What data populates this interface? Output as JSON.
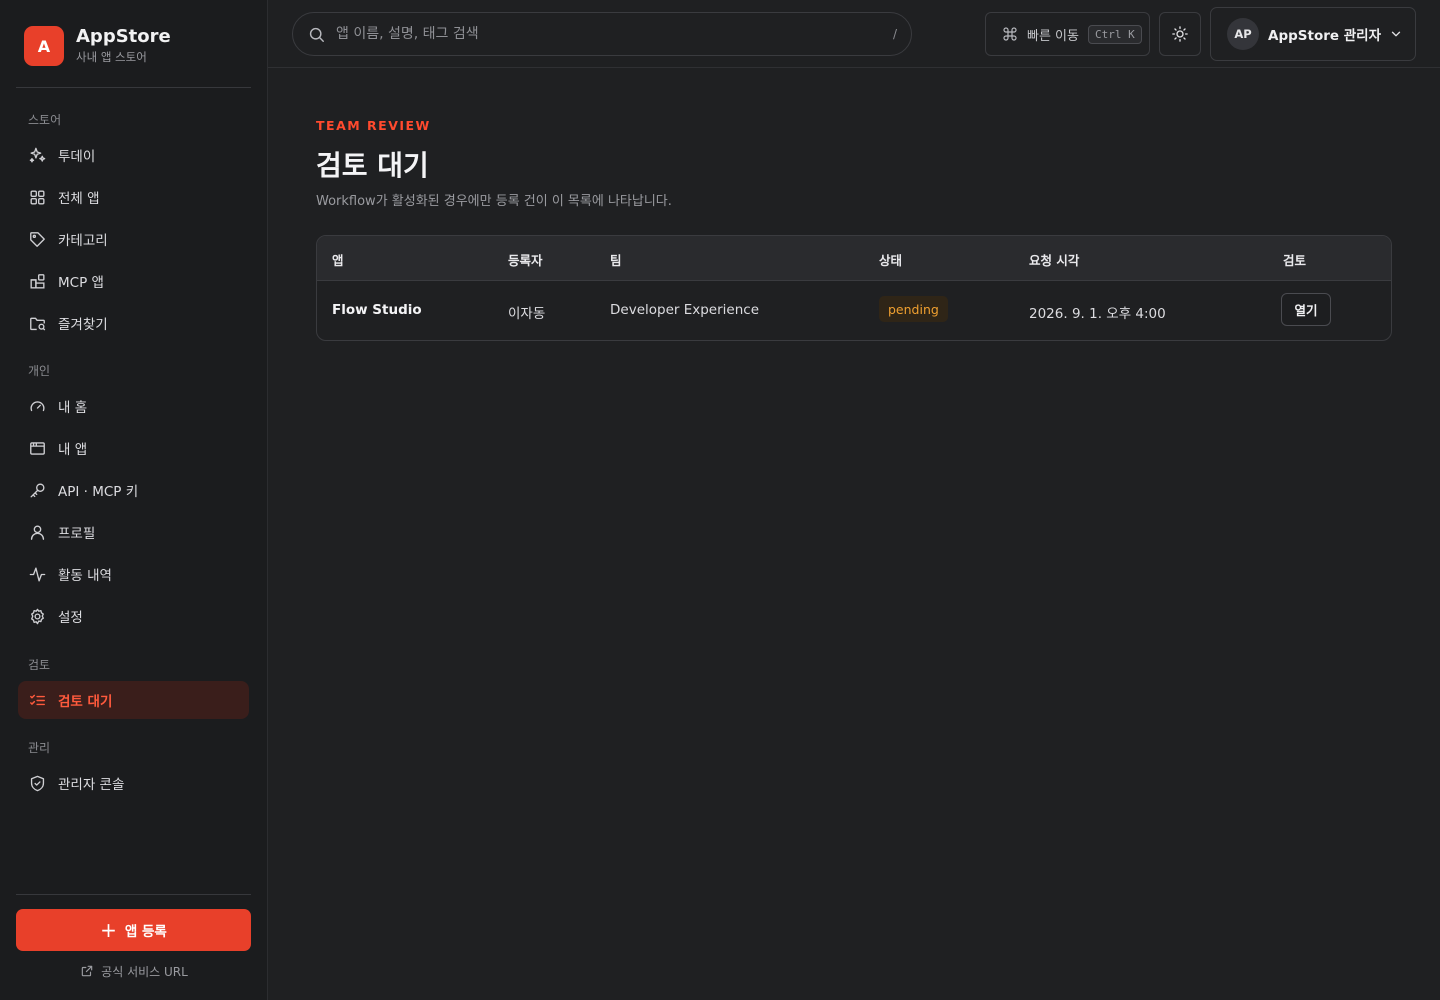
{
  "brand": {
    "logo_letter": "A",
    "name": "AppStore",
    "subtitle": "사내 앱 스토어"
  },
  "sidebar": {
    "sections": {
      "store": "스토어",
      "personal": "개인",
      "review": "검토",
      "admin": "관리"
    },
    "items": [
      {
        "label": "투데이",
        "icon": "sparkles-icon"
      },
      {
        "label": "전체 앱",
        "icon": "grid-icon"
      },
      {
        "label": "카테고리",
        "icon": "tag-icon"
      },
      {
        "label": "MCP 앱",
        "icon": "blocks-icon"
      },
      {
        "label": "즐겨찾기",
        "icon": "folder-search-icon"
      },
      {
        "label": "내 홈",
        "icon": "gauge-icon"
      },
      {
        "label": "내 앱",
        "icon": "app-window-icon"
      },
      {
        "label": "API · MCP 키",
        "icon": "key-icon"
      },
      {
        "label": "프로필",
        "icon": "user-icon"
      },
      {
        "label": "활동 내역",
        "icon": "activity-icon"
      },
      {
        "label": "설정",
        "icon": "gear-icon"
      },
      {
        "label": "검토 대기",
        "icon": "list-checks-icon",
        "active": true
      },
      {
        "label": "관리자 콘솔",
        "icon": "shield-icon"
      }
    ],
    "register_label": "앱 등록",
    "official_link_label": "공식 서비스 URL"
  },
  "header": {
    "search_placeholder": "앱 이름, 설명, 태그 검색",
    "search_shortcut": "/",
    "quick_label": "빠른 이동",
    "quick_shortcut": "Ctrl K",
    "user_initials": "AP",
    "user_name": "AppStore 관리자"
  },
  "main": {
    "eyebrow": "TEAM REVIEW",
    "title": "검토 대기",
    "description": "Workflow가 활성화된 경우에만 등록 건이 이 목록에 나타납니다.",
    "table": {
      "columns": [
        "앱",
        "등록자",
        "팀",
        "상태",
        "요청 시각",
        "검토"
      ],
      "rows": [
        {
          "app": "Flow Studio",
          "registrant": "이자동",
          "team": "Developer Experience",
          "status": "pending",
          "requested_at": "2026. 9. 1. 오후 4:00",
          "action": "열기"
        }
      ]
    }
  },
  "colors": {
    "accent": "#e8402a",
    "pending": "#f0a030",
    "background": "#1f2022",
    "sidebar": "#1b1c1e"
  }
}
